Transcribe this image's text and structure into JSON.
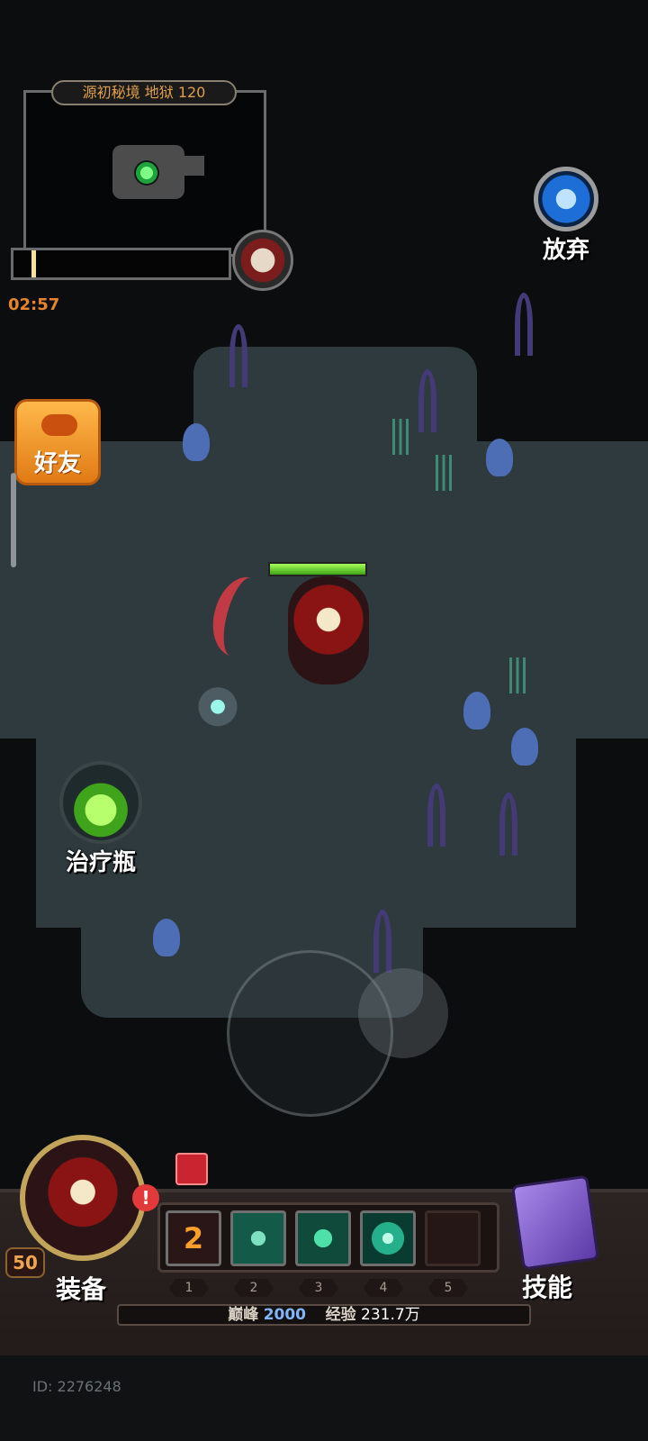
{
  "minimap": {
    "title": "源初秘境 地狱 120",
    "timer": "02:57",
    "progress_fraction": 0.02
  },
  "buttons": {
    "abandon_label": "放弃",
    "friends_label": "好友",
    "potion_label": "治疗瓶",
    "equip_label": "装备",
    "skill_label": "技能"
  },
  "hero": {
    "level": "50",
    "alert": "!",
    "hp_fraction": 1.0
  },
  "skill_bar": {
    "slots": [
      {
        "num": "1",
        "icon": "ability-charge-icon",
        "count": "2"
      },
      {
        "num": "2",
        "icon": "slash-skill-icon"
      },
      {
        "num": "3",
        "icon": "wind-skill-icon"
      },
      {
        "num": "4",
        "icon": "vortex-skill-icon"
      },
      {
        "num": "5",
        "icon": "empty-slot"
      }
    ]
  },
  "xp": {
    "peak_label": "巅峰",
    "peak_value": "2000",
    "exp_label": "经验",
    "exp_value": "231.7万"
  },
  "player_id": "ID: 2276248",
  "colors": {
    "timer": "#e8832b",
    "title_text": "#e0a04b",
    "hp_bar": "#3fa316",
    "background": "#0b0d0e",
    "floor": "#2f3a3e"
  }
}
